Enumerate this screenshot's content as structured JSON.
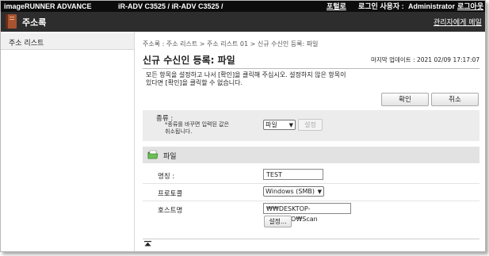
{
  "topbar": {
    "product": "imageRUNNER ADVANCE",
    "device": "iR-ADV C3525 / iR-ADV C3525 /",
    "portal": "포털로",
    "login_label": "로그인 사용자 :",
    "user": "Administrator",
    "logout": "로그아웃"
  },
  "navbar": {
    "title": "주소록",
    "admin_link": "관리자에게 메일"
  },
  "sidebar": {
    "items": [
      {
        "label": "주소 리스트"
      }
    ]
  },
  "main": {
    "breadcrumb": "주소록 : 주소 리스트 > 주소 리스트 01 > 신규 수신인 등록: 파일",
    "title": "신규 수신인 등록: 파일",
    "last_updated": "마지막 업데이트 : 2021 02/09 17:17:07",
    "instruction_line1": "모든 항목을 설정하고 나서 [확인]을 클릭해 주십시오. 설정하지 않은 항목이",
    "instruction_line2": "있다면 [확인]을 클릭할 수 없습니다.",
    "ok_label": "확인",
    "cancel_label": "취소"
  },
  "type_panel": {
    "label": "종류 :",
    "note_line1": "*종류를 바꾸면 입력된 값은",
    "note_line2": "취소됩니다.",
    "selected": "파일",
    "set_label": "설정"
  },
  "file_section": {
    "header": "파일",
    "name_label": "명칭 :",
    "name_value": "TEST",
    "protocol_label": "프로토콜",
    "protocol_value": "Windows (SMB)",
    "host_label": "호스트명",
    "host_value": "₩₩DESKTOP-1VP6B8O₩Scan",
    "settings_label": "설정..."
  },
  "colors": {
    "topbar": "#0c0c0c",
    "navbar": "#2d2d2d",
    "panel": "#ececec",
    "section_header": "#e2e2e2"
  },
  "icons": {
    "app": "address-book-icon",
    "section": "file-folder-icon",
    "scroll_top": "scroll-top-icon"
  }
}
